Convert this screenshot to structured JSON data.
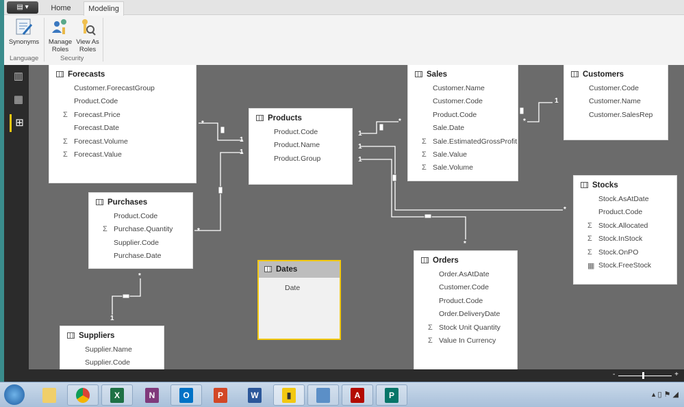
{
  "ribbon": {
    "tabs": [
      "Home",
      "Modeling"
    ],
    "active_tab": "Modeling",
    "buttons": {
      "synonyms": "Synonyms",
      "manage_roles_1": "Manage",
      "manage_roles_2": "Roles",
      "view_as_1": "View As",
      "view_as_2": "Roles"
    },
    "groups": {
      "language": "Language",
      "security": "Security"
    }
  },
  "nav": [
    "report-view",
    "data-view",
    "relationships-view"
  ],
  "tables": [
    {
      "name": "Forecasts",
      "fields": [
        [
          "",
          "Customer.ForecastGroup"
        ],
        [
          "",
          "Product.Code"
        ],
        [
          "Σ",
          "Forecast.Price"
        ],
        [
          "",
          "Forecast.Date"
        ],
        [
          "Σ",
          "Forecast.Volume"
        ],
        [
          "Σ",
          "Forecast.Value"
        ]
      ]
    },
    {
      "name": "Products",
      "fields": [
        [
          "",
          "Product.Code"
        ],
        [
          "",
          "Product.Name"
        ],
        [
          "",
          "Product.Group"
        ]
      ]
    },
    {
      "name": "Sales",
      "fields": [
        [
          "",
          "Customer.Name"
        ],
        [
          "",
          "Customer.Code"
        ],
        [
          "",
          "Product.Code"
        ],
        [
          "",
          "Sale.Date"
        ],
        [
          "Σ",
          "Sale.EstimatedGrossProfit"
        ],
        [
          "Σ",
          "Sale.Value"
        ],
        [
          "Σ",
          "Sale.Volume"
        ]
      ]
    },
    {
      "name": "Customers",
      "fields": [
        [
          "",
          "Customer.Code"
        ],
        [
          "",
          "Customer.Name"
        ],
        [
          "",
          "Customer.SalesRep"
        ]
      ]
    },
    {
      "name": "Stocks",
      "fields": [
        [
          "",
          "Stock.AsAtDate"
        ],
        [
          "",
          "Product.Code"
        ],
        [
          "Σ",
          "Stock.Allocated"
        ],
        [
          "Σ",
          "Stock.InStock"
        ],
        [
          "Σ",
          "Stock.OnPO"
        ],
        [
          "▦",
          "Stock.FreeStock"
        ]
      ]
    },
    {
      "name": "Purchases",
      "fields": [
        [
          "",
          "Product.Code"
        ],
        [
          "Σ",
          "Purchase.Quantity"
        ],
        [
          "",
          "Supplier.Code"
        ],
        [
          "",
          "Purchase.Date"
        ]
      ]
    },
    {
      "name": "Dates",
      "fields": [
        [
          "",
          "Date"
        ]
      ]
    },
    {
      "name": "Orders",
      "fields": [
        [
          "",
          "Order.AsAtDate"
        ],
        [
          "",
          "Customer.Code"
        ],
        [
          "",
          "Product.Code"
        ],
        [
          "",
          "Order.DeliveryDate"
        ],
        [
          "Σ",
          "Stock Unit Quantity"
        ],
        [
          "Σ",
          "Value In Currency"
        ]
      ]
    },
    {
      "name": "Suppliers",
      "fields": [
        [
          "",
          "Supplier.Name"
        ],
        [
          "",
          "Supplier.Code"
        ]
      ]
    }
  ],
  "cardinality": {
    "one": "1",
    "many": "*"
  },
  "zoom": {
    "minus": "-",
    "plus": "+",
    "level": 0.45
  },
  "taskbar": [
    "start",
    "explorer",
    "chrome",
    "excel",
    "onenote",
    "outlook",
    "powerpoint",
    "word",
    "power-bi",
    "control-panel",
    "acrobat",
    "publisher"
  ],
  "colors": {
    "accent": "#f2c811",
    "canvas": "#6b6b6b"
  }
}
